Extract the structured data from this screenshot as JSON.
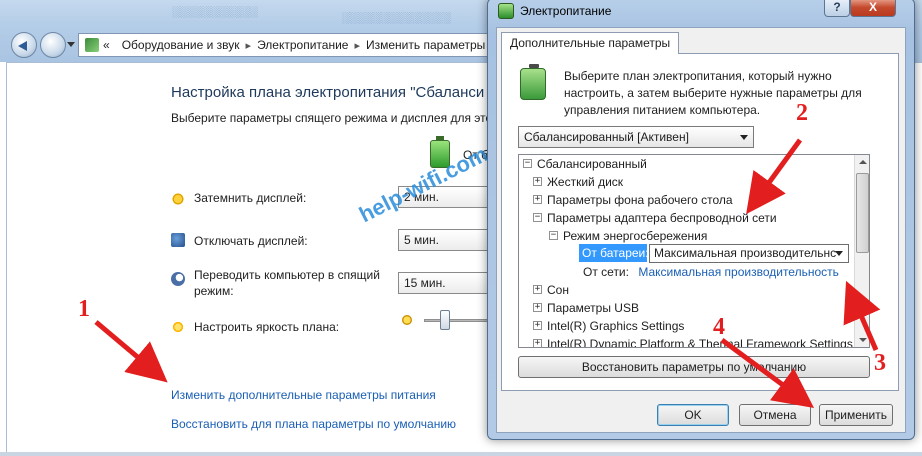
{
  "control_panel": {
    "breadcrumb": {
      "root_chevron": "«",
      "items": [
        "Оборудование и звук",
        "Электропитание",
        "Изменить параметры"
      ]
    },
    "title": "Настройка плана электропитания \"Сбаланси",
    "subtitle": "Выберите параметры спящего режима и дисплея для это",
    "column_on_battery": "От б",
    "rows": [
      {
        "label": "Затемнить дисплей:",
        "value": "2 мин."
      },
      {
        "label": "Отключать дисплей:",
        "value": "5 мин."
      },
      {
        "label": "Переводить компьютер в спящий",
        "label2": "режим:",
        "value": "15 мин."
      },
      {
        "label": "Настроить яркость плана:"
      }
    ],
    "brightness_level": 0.3,
    "links": {
      "advanced": "Изменить дополнительные параметры питания",
      "restore": "Восстановить для плана параметры по умолчанию"
    }
  },
  "dialog": {
    "title": "Электропитание",
    "help_label": "?",
    "close_label": "X",
    "tab": "Дополнительные параметры",
    "intro": "Выберите план электропитания, который нужно настроить, а затем выберите нужные параметры для управления питанием компьютера.",
    "plan": "Сбалансированный [Активен]",
    "tree": {
      "plan_node": "Сбалансированный",
      "hdd": "Жесткий диск",
      "desktop_bg": "Параметры фона рабочего стола",
      "wireless": "Параметры адаптера беспроводной сети",
      "power_save": "Режим энергосбережения",
      "on_battery_label": "От батареи:",
      "on_battery_value": "Максимальная производительнс",
      "on_ac_label": "От сети:",
      "on_ac_value": "Максимальная производительность",
      "sleep": "Сон",
      "usb": "Параметры USB",
      "intel_graphics": "Intel(R) Graphics Settings",
      "intel_dptf": "Intel(R) Dynamic Platform & Thermal Framework Settings"
    },
    "restore_button": "Восстановить параметры по умолчанию",
    "buttons": {
      "ok": "OK",
      "cancel": "Отмена",
      "apply": "Применить"
    }
  },
  "annotations": {
    "n1": "1",
    "n2": "2",
    "n3": "3",
    "n4": "4",
    "watermark": "help-wifi.com",
    "arrow_color": "#e31e1e"
  }
}
